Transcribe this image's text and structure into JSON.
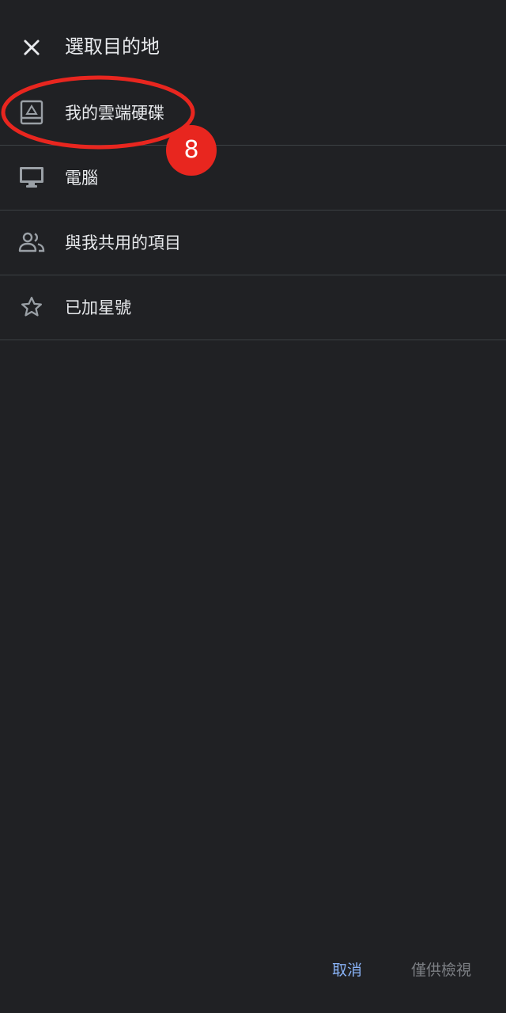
{
  "header": {
    "title": "選取目的地",
    "close_icon": "close-icon"
  },
  "destinations": [
    {
      "label": "我的雲端硬碟",
      "icon": "drive-icon"
    },
    {
      "label": "電腦",
      "icon": "computer-icon"
    },
    {
      "label": "與我共用的項目",
      "icon": "shared-people-icon"
    },
    {
      "label": "已加星號",
      "icon": "star-outline-icon"
    }
  ],
  "annotation": {
    "badge": "8",
    "color": "#e8261f"
  },
  "footer": {
    "cancel_label": "取消",
    "view_only_label": "僅供檢視"
  },
  "colors": {
    "background": "#202124",
    "accent": "#8ab4f8",
    "divider": "#3c4043",
    "icon": "#9aa0a6"
  }
}
